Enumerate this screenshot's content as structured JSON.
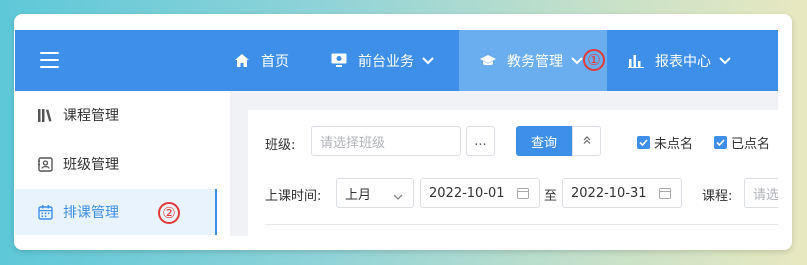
{
  "nav": {
    "home": "首页",
    "front_desk": "前台业务",
    "academic": "教务管理",
    "reports": "报表中心",
    "marker1": "①"
  },
  "sidebar": {
    "items": [
      {
        "label": "课程管理",
        "icon": "books-icon"
      },
      {
        "label": "班级管理",
        "icon": "contact-card-icon"
      },
      {
        "label": "排课管理",
        "icon": "calendar-icon",
        "active": true
      }
    ],
    "marker2": "②"
  },
  "filters": {
    "class_label": "班级:",
    "class_placeholder": "请选择班级",
    "more_button": "...",
    "query_button": "查询",
    "collapse_icon": "double-chevron-up-icon",
    "unmarked_label": "未点名",
    "marked_label": "已点名",
    "time_label": "上课时间:",
    "period_select": "上月",
    "date_from": "2022-10-01",
    "date_sep": "至",
    "date_to": "2022-10-31",
    "course_label": "课程:",
    "course_placeholder": "请选"
  },
  "colors": {
    "primary": "#3d8fe8",
    "active_nav": "#6aaef0",
    "marker": "#e03a3a"
  }
}
